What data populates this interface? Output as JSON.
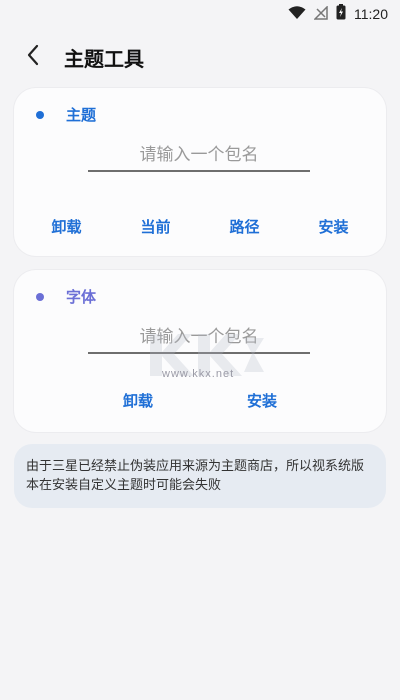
{
  "status_bar": {
    "time": "11:20",
    "icons": [
      "wifi-icon",
      "no-signal-icon",
      "battery-charging-icon"
    ]
  },
  "header": {
    "back_icon": "back-chevron-icon",
    "title": "主题工具"
  },
  "theme_card": {
    "title": "主题",
    "dot_color": "#1f6fd6",
    "title_color": "#1f6fd6",
    "input_placeholder": "请输入一个包名",
    "input_value": "",
    "actions": [
      "卸载",
      "当前",
      "路径",
      "安装"
    ]
  },
  "font_card": {
    "title": "字体",
    "dot_color": "#6b6fd6",
    "title_color": "#6b6fd6",
    "input_placeholder": "请输入一个包名",
    "input_value": "",
    "actions": [
      "卸载",
      "安装"
    ]
  },
  "notice": {
    "text": "由于三星已经禁止伪装应用来源为主题商店，所以视系统版本在安装自定义主题时可能会失败"
  },
  "watermark": {
    "url": "www.kkx.net"
  },
  "colors": {
    "accent": "#1f6fd6",
    "background": "#f4f4f6",
    "card": "#fcfcfd",
    "notice_bg": "#e6ebf2"
  }
}
